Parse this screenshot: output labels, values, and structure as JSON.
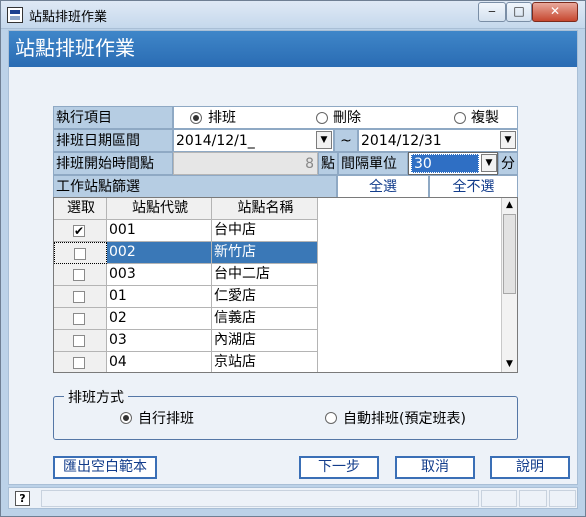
{
  "window": {
    "title": "站點排班作業",
    "min": "‒",
    "max": "□",
    "close": "✕"
  },
  "header": {
    "title": "站點排班作業"
  },
  "form": {
    "exec_label": "執行項目",
    "options": [
      "排班",
      "刪除",
      "複製"
    ],
    "date_label": "排班日期區間",
    "date_from": "2014/12/1_",
    "tilde": "~",
    "date_to": "2014/12/31",
    "start_label": "排班開始時間點",
    "start_value": "8",
    "dian": "點",
    "interval_label": "間隔單位",
    "interval_value": "30",
    "fen": "分",
    "filter_label": "工作站點篩選",
    "select_all": "全選",
    "select_none": "全不選"
  },
  "grid": {
    "headers": [
      "選取",
      "站點代號",
      "站點名稱"
    ],
    "rows": [
      {
        "checked": "✔",
        "code": "001",
        "name": "台中店"
      },
      {
        "checked": "",
        "code": "002",
        "name": "新竹店"
      },
      {
        "checked": "",
        "code": "003",
        "name": "台中二店"
      },
      {
        "checked": "",
        "code": "01",
        "name": "仁愛店"
      },
      {
        "checked": "",
        "code": "02",
        "name": "信義店"
      },
      {
        "checked": "",
        "code": "03",
        "name": "內湖店"
      },
      {
        "checked": "",
        "code": "04",
        "name": "京站店"
      }
    ]
  },
  "mode": {
    "title": "排班方式",
    "manual": "自行排班",
    "auto": "自動排班(預定班表)"
  },
  "buttons": {
    "export": "匯出空白範本",
    "next": "下一步",
    "cancel": "取消",
    "help": "說明"
  },
  "status": {
    "help_icon": "?"
  }
}
